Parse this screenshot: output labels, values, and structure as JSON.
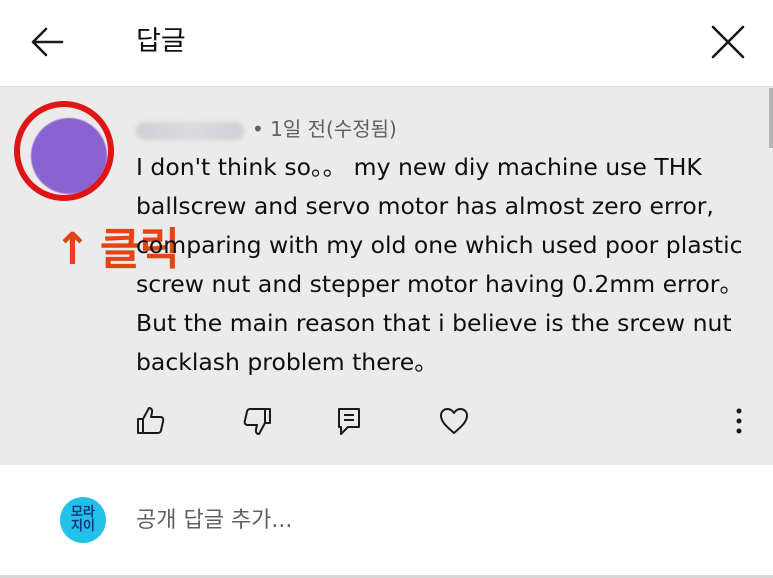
{
  "header": {
    "title": "답글",
    "back_icon": "arrow-left-icon",
    "close_icon": "close-icon"
  },
  "comment": {
    "time": "• 1일 전(수정됨)",
    "text": "I don't think so。。 my new diy machine use THK ballscrew and servo motor has almost zero error, comparing with my old one which used poor plastic screw nut and stepper motor having 0.2mm error。 But the main reason that i believe is the srcew nut backlash problem there。",
    "annotation_arrow": "↑",
    "annotation_text": "클릭",
    "annotation_color": "#e24413"
  },
  "actions": {
    "like_icon": "thumbs-up-icon",
    "dislike_icon": "thumbs-down-icon",
    "reply_icon": "reply-comment-icon",
    "heart_icon": "heart-icon",
    "more_icon": "more-vert-icon"
  },
  "reply": {
    "avatar_line1": "모라",
    "avatar_line2": "지이",
    "placeholder": "공개 답글 추가..."
  },
  "colors": {
    "comment_bg": "#ebebeb",
    "ring": "#e01515",
    "avatar": "#8b63d1",
    "user_avatar": "#22c1ea"
  }
}
